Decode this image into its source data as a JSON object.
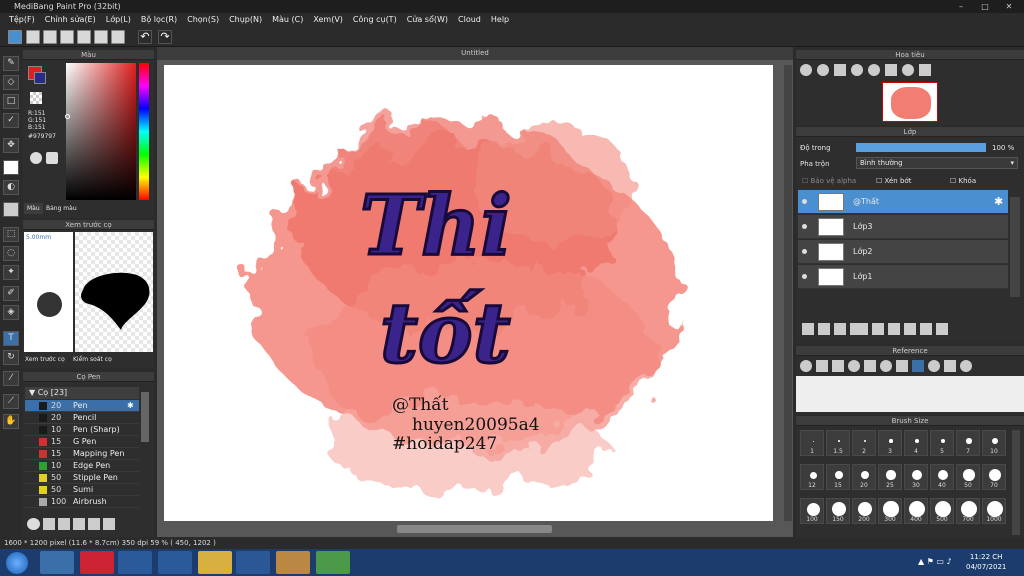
{
  "window": {
    "title": "MediBang Paint Pro (32bit)"
  },
  "menu": [
    "Tệp(F)",
    "Chỉnh sửa(E)",
    "Lớp(L)",
    "Bộ lọc(R)",
    "Chọn(S)",
    "Chụp(N)",
    "Màu (C)",
    "Xem(V)",
    "Công cụ(T)",
    "Cửa sổ(W)",
    "Cloud",
    "Help"
  ],
  "color_panel": {
    "title": "Màu",
    "r": "R:151",
    "g": "G:151",
    "b": "B:151",
    "hex": "#979797",
    "tab_color": "Màu",
    "tab_palette": "Bảng màu",
    "primary": "#e02020",
    "secondary": "#2a2a8a"
  },
  "brush_preview": {
    "title": "Xem trước cọ",
    "size": "5.00mm",
    "tab_preview": "Xem trước cọ",
    "tab_control": "Kiểm soát cọ"
  },
  "brush_list": {
    "title": "Cọ Pen",
    "group": "Cọ [23]",
    "items": [
      {
        "num": "20",
        "name": "Pen",
        "color": "#1a1a1a"
      },
      {
        "num": "20",
        "name": "Pencil",
        "color": "#1a1a1a"
      },
      {
        "num": "10",
        "name": "Pen (Sharp)",
        "color": "#1a1a1a"
      },
      {
        "num": "15",
        "name": "G Pen",
        "color": "#d03030"
      },
      {
        "num": "15",
        "name": "Mapping Pen",
        "color": "#d03030"
      },
      {
        "num": "10",
        "name": "Edge Pen",
        "color": "#30a030"
      },
      {
        "num": "50",
        "name": "Stipple Pen",
        "color": "#e0d020"
      },
      {
        "num": "50",
        "name": "Sumi",
        "color": "#e0d020"
      },
      {
        "num": "100",
        "name": "Airbrush",
        "color": "#aaaaaa"
      }
    ]
  },
  "document": {
    "tab_title": "Untitled"
  },
  "artwork": {
    "line1": "Thi",
    "line2": "tốt",
    "credit1": "@Thất",
    "credit2": "huyen20095a4",
    "credit3": "#hoidap247"
  },
  "navigator": {
    "title": "Hoa tiêu"
  },
  "layers": {
    "title": "Lớp",
    "opacity_label": "Độ trong",
    "opacity_value": "100 %",
    "blend_label": "Pha trộn",
    "blend_value": "Bình thường",
    "protect_alpha": "Bảo vệ alpha",
    "clipping": "Xén bớt",
    "lock": "Khóa",
    "items": [
      "@Thất",
      "Lớp3",
      "Lớp2",
      "Lớp1"
    ]
  },
  "reference": {
    "title": "Reference"
  },
  "brush_size": {
    "title": "Brush Size",
    "sizes": [
      "1",
      "1.5",
      "2",
      "3",
      "4",
      "5",
      "7",
      "10",
      "12",
      "15",
      "20",
      "25",
      "30",
      "40",
      "50",
      "70",
      "100",
      "150",
      "200",
      "300",
      "400",
      "500",
      "700",
      "1000"
    ]
  },
  "status": {
    "text": "1600 * 1200 pixel  (11.6 * 8.7cm)  350 dpi  59 %  ( 450, 1202 )"
  },
  "taskbar": {
    "time": "11:22 CH",
    "date": "04/07/2021"
  }
}
